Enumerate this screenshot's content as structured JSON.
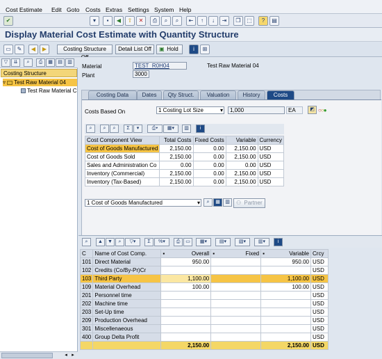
{
  "menu": [
    "Cost Estimate",
    "Edit",
    "Goto",
    "Costs",
    "Extras",
    "Settings",
    "System",
    "Help"
  ],
  "title": "Display Material Cost Estimate with Quantity Structure",
  "toolbar2": {
    "costing_structure_off": "Costing Structure Off",
    "detail_list_off": "Detail List Off",
    "hold": "Hold"
  },
  "left": {
    "header": "Costing Structure",
    "root": "Test Raw Material 04",
    "child": "Test Raw Material C"
  },
  "header": {
    "material_label": "Material",
    "material_value": "TEST_R0H04",
    "material_desc": "Test Raw Material 04",
    "plant_label": "Plant",
    "plant_value": "3000"
  },
  "tabs": [
    "Costing Data",
    "Dates",
    "Qty Struct.",
    "Valuation",
    "History",
    "Costs"
  ],
  "costs": {
    "based_on_label": "Costs Based On",
    "based_on_value": "1 Costing Lot Size",
    "qty": "1,000",
    "unit": "EA"
  },
  "view_table": {
    "headers": [
      "Cost Component View",
      "Total Costs",
      "Fixed Costs",
      "Variable",
      "Currency"
    ],
    "rows": [
      [
        "Cost of Goods Manufactured",
        "2,150.00",
        "0.00",
        "2,150.00",
        "USD"
      ],
      [
        "Cost of Goods Sold",
        "2,150.00",
        "0.00",
        "2,150.00",
        "USD"
      ],
      [
        "Sales and Administration Co",
        "0.00",
        "0.00",
        "0.00",
        "USD"
      ],
      [
        "Inventory (Commercial)",
        "2,150.00",
        "0.00",
        "2,150.00",
        "USD"
      ],
      [
        "Inventory (Tax-Based)",
        "2,150.00",
        "0.00",
        "2,150.00",
        "USD"
      ]
    ]
  },
  "view_select": "1 Cost of Goods Manufactured",
  "partner": "Partner",
  "comp_table": {
    "headers": [
      "C",
      "Name of Cost Comp.",
      "Overall",
      "Fixed",
      "Variable",
      "Crcy"
    ],
    "rows": [
      [
        "101",
        "Direct Material",
        "950.00",
        "",
        "950.00",
        "USD"
      ],
      [
        "102",
        "Credits (Co/By-Pr)Cr",
        "",
        "",
        "",
        "USD"
      ],
      [
        "103",
        "Third Party",
        "1,100.00",
        "",
        "1,100.00",
        "USD"
      ],
      [
        "109",
        "Material Overhead",
        "100.00",
        "",
        "100.00",
        "USD"
      ],
      [
        "201",
        "Personnel time",
        "",
        "",
        "",
        "USD"
      ],
      [
        "202",
        "Machine time",
        "",
        "",
        "",
        "USD"
      ],
      [
        "203",
        "Set-Up time",
        "",
        "",
        "",
        "USD"
      ],
      [
        "209",
        "Production Overhead",
        "",
        "",
        "",
        "USD"
      ],
      [
        "301",
        "Miscellenaeous",
        "",
        "",
        "",
        "USD"
      ],
      [
        "400",
        "Group Delta Profit",
        "",
        "",
        "",
        "USD"
      ]
    ],
    "total": {
      "overall": "2,150.00",
      "variable": "2,150.00",
      "crcy": "USD"
    }
  }
}
